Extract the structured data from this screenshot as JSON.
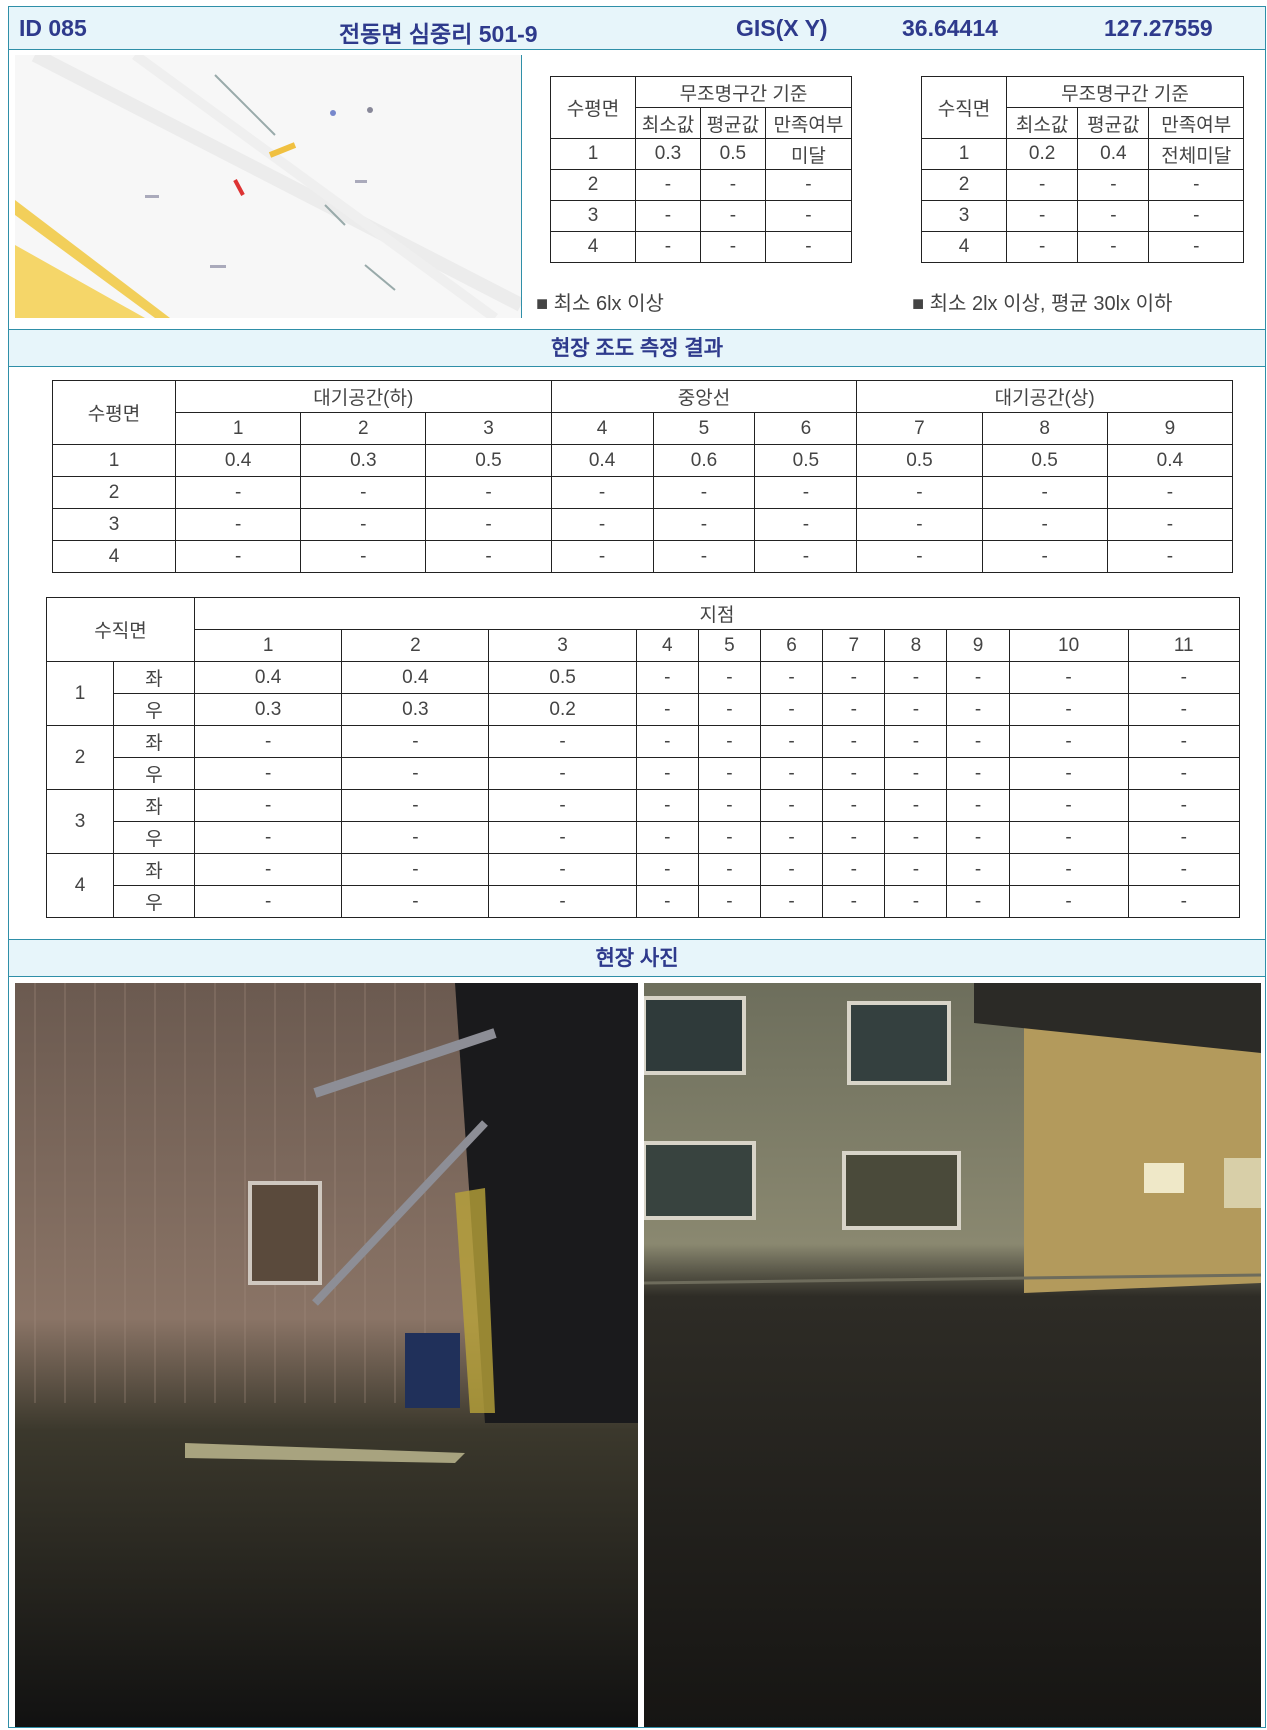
{
  "header": {
    "id": "ID  085",
    "address": "전동면 심중리 501-9",
    "gis_label": "GIS(X Y)",
    "x": "36.64414",
    "y": "127.27559"
  },
  "colors": {
    "accent": "#2f8fa8",
    "header_bg": "#e7f5fa",
    "title_text": "#2e3a8c"
  },
  "standards": {
    "horizontal": {
      "corner": "수평면",
      "group": "무조명구간 기준",
      "cols": [
        "최소값",
        "평균값",
        "만족여부"
      ],
      "rows": [
        [
          "1",
          "0.3",
          "0.5",
          "미달"
        ],
        [
          "2",
          "-",
          "-",
          "-"
        ],
        [
          "3",
          "-",
          "-",
          "-"
        ],
        [
          "4",
          "-",
          "-",
          "-"
        ]
      ],
      "note": "■ 최소 6lx 이상"
    },
    "vertical": {
      "corner": "수직면",
      "group": "무조명구간 기준",
      "cols": [
        "최소값",
        "평균값",
        "만족여부"
      ],
      "rows": [
        [
          "1",
          "0.2",
          "0.4",
          "전체미달"
        ],
        [
          "2",
          "-",
          "-",
          "-"
        ],
        [
          "3",
          "-",
          "-",
          "-"
        ],
        [
          "4",
          "-",
          "-",
          "-"
        ]
      ],
      "note": "■ 최소 2lx 이상, 평균 30lx 이하"
    }
  },
  "measure": {
    "title": "현장 조도 측정 결과",
    "horizontal": {
      "corner": "수평면",
      "groups": [
        "대기공간(하)",
        "중앙선",
        "대기공간(상)"
      ],
      "points": [
        "1",
        "2",
        "3",
        "4",
        "5",
        "6",
        "7",
        "8",
        "9"
      ],
      "rows": [
        [
          "1",
          "0.4",
          "0.3",
          "0.5",
          "0.4",
          "0.6",
          "0.5",
          "0.5",
          "0.5",
          "0.4"
        ],
        [
          "2",
          "-",
          "-",
          "-",
          "-",
          "-",
          "-",
          "-",
          "-",
          "-"
        ],
        [
          "3",
          "-",
          "-",
          "-",
          "-",
          "-",
          "-",
          "-",
          "-",
          "-"
        ],
        [
          "4",
          "-",
          "-",
          "-",
          "-",
          "-",
          "-",
          "-",
          "-",
          "-"
        ]
      ]
    },
    "vertical": {
      "corner": "수직면",
      "group": "지점",
      "points": [
        "1",
        "2",
        "3",
        "4",
        "5",
        "6",
        "7",
        "8",
        "9",
        "10",
        "11"
      ],
      "rows": [
        {
          "n": "1",
          "left": [
            "0.4",
            "0.4",
            "0.5",
            "-",
            "-",
            "-",
            "-",
            "-",
            "-",
            "-",
            "-"
          ],
          "right": [
            "0.3",
            "0.3",
            "0.2",
            "-",
            "-",
            "-",
            "-",
            "-",
            "-",
            "-",
            "-"
          ]
        },
        {
          "n": "2",
          "left": [
            "-",
            "-",
            "-",
            "-",
            "-",
            "-",
            "-",
            "-",
            "-",
            "-",
            "-"
          ],
          "right": [
            "-",
            "-",
            "-",
            "-",
            "-",
            "-",
            "-",
            "-",
            "-",
            "-",
            "-"
          ]
        },
        {
          "n": "3",
          "left": [
            "-",
            "-",
            "-",
            "-",
            "-",
            "-",
            "-",
            "-",
            "-",
            "-",
            "-"
          ],
          "right": [
            "-",
            "-",
            "-",
            "-",
            "-",
            "-",
            "-",
            "-",
            "-",
            "-",
            "-"
          ]
        },
        {
          "n": "4",
          "left": [
            "-",
            "-",
            "-",
            "-",
            "-",
            "-",
            "-",
            "-",
            "-",
            "-",
            "-"
          ],
          "right": [
            "-",
            "-",
            "-",
            "-",
            "-",
            "-",
            "-",
            "-",
            "-",
            "-",
            "-"
          ]
        }
      ],
      "side_left": "좌",
      "side_right": "우"
    }
  },
  "photos": {
    "title": "현장 사진"
  }
}
